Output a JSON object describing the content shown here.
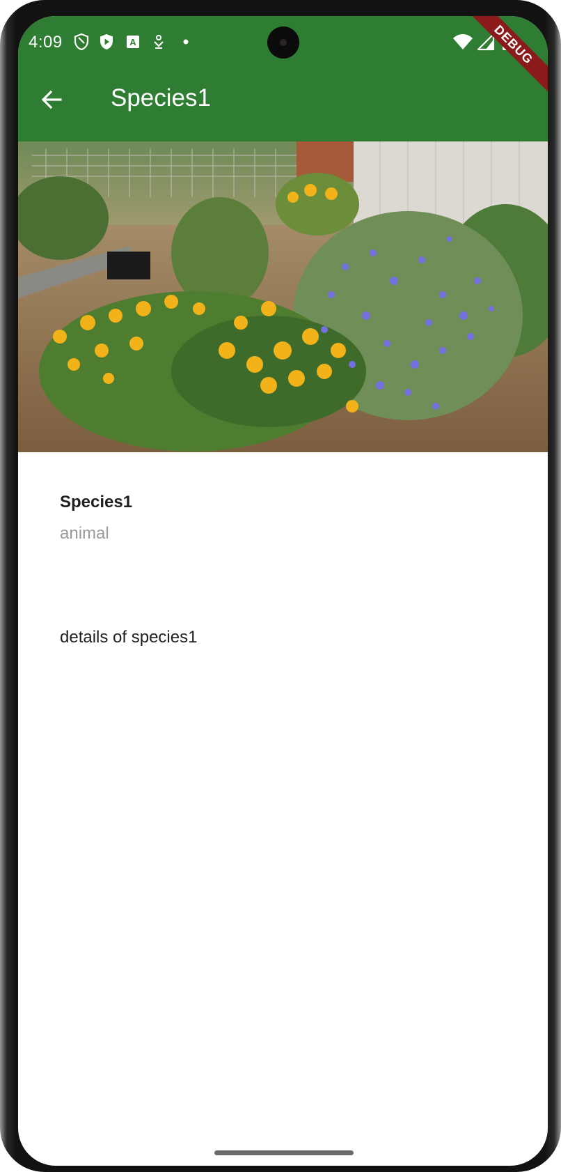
{
  "status_bar": {
    "time": "4:09",
    "left_icons": [
      "shield-outline-icon",
      "shield-play-icon",
      "translate-a-icon",
      "download-icon",
      "dot-icon"
    ],
    "right_icons": [
      "wifi-icon",
      "cellular-signal-icon",
      "battery-icon"
    ]
  },
  "debug_banner": "DEBUG",
  "app_bar": {
    "title": "Species1",
    "back_icon": "arrow-back-icon",
    "color": "#2e7d32"
  },
  "hero_image": {
    "subject": "garden-flower-bed-photo"
  },
  "species": {
    "name": "Species1",
    "kind": "animal",
    "details": "details of species1"
  },
  "colors": {
    "primary": "#2e7d32",
    "subtitle": "#9a9a9a",
    "text": "#1f1f1f"
  }
}
